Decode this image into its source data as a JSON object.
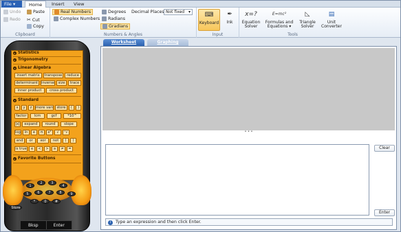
{
  "ribbon_tabs": {
    "file": "File",
    "home": "Home",
    "insert": "Insert",
    "view": "View"
  },
  "clipboard": {
    "undo": "Undo",
    "redo": "Redo",
    "paste": "Paste",
    "cut": "Cut",
    "copy": "Copy",
    "label": "Clipboard"
  },
  "numbers": {
    "real": "Real Numbers",
    "complex": "Complex Numbers",
    "degrees": "Degrees",
    "radians": "Radians",
    "gradians": "Gradians",
    "decimal_places_label": "Decimal Places",
    "decimal_places_value": "Not fixed",
    "label": "Numbers & Angles"
  },
  "input_group": {
    "keyboard": "Keyboard",
    "ink": "Ink",
    "label": "Input"
  },
  "tools": {
    "equation_solver_line1": "Equation",
    "equation_solver_line2": "Solver",
    "formulas_line1": "Formulas and",
    "formulas_line2": "Equations ▾",
    "triangle_line1": "Triangle",
    "triangle_line2": "Solver",
    "unit_line1": "Unit",
    "unit_line2": "Converter",
    "label": "Tools"
  },
  "calc": {
    "statistics": "Statistics",
    "trigonometry": "Trigonometry",
    "linear_algebra": "Linear Algebra",
    "la_keys": [
      "insert matrix",
      "transpose",
      "reduce",
      "determinant",
      "inverse",
      "size",
      "trace",
      "inner product",
      "cross product"
    ],
    "standard": "Standard",
    "std_keys": [
      "x",
      "y",
      "z",
      "more vars",
      "store",
      "(",
      ")",
      "factor",
      "lcm",
      "gcf",
      "*10^",
      "|x|",
      "expand",
      "round",
      "slope",
      "log",
      "ln",
      "e",
      "π",
      "x²",
      "√",
      "ⁿ√",
      "and",
      "or",
      "xor",
      "not",
      "(",
      ")",
      "is true",
      "≤",
      "<",
      ">",
      "≥",
      "≠",
      "="
    ],
    "favorite": "Favorite Buttons",
    "bksp": "Bksp",
    "enter": "Enter",
    "store": "Store"
  },
  "main": {
    "tab_worksheet": "Worksheet",
    "tab_graphing": "Graphing",
    "clear": "Clear",
    "enter": "Enter",
    "status": "Type an expression and then click Enter.",
    "splitter": "• • •"
  }
}
